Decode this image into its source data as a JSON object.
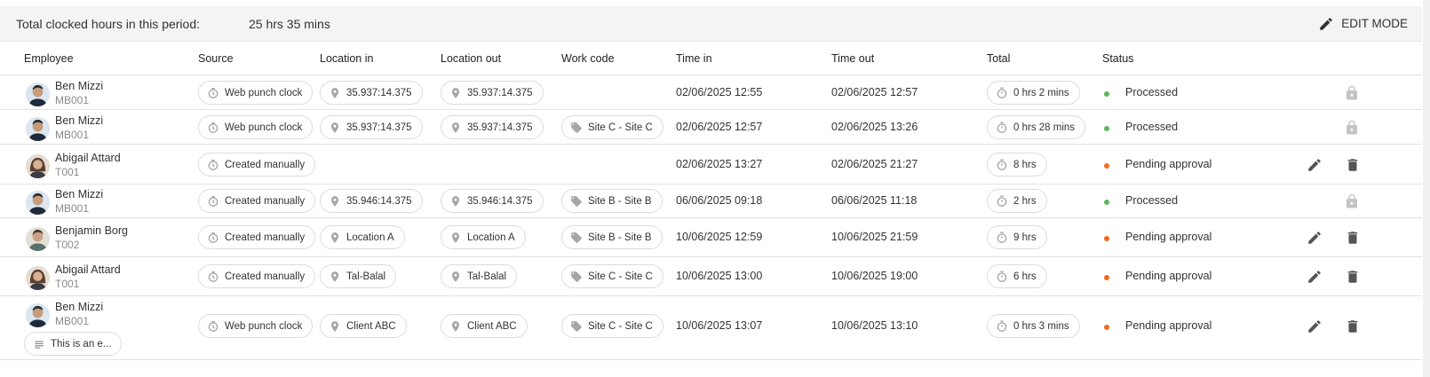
{
  "summary": {
    "label": "Total clocked hours in this period:",
    "value": "25 hrs 35 mins",
    "edit_mode_label": "EDIT MODE"
  },
  "columns": [
    "Employee",
    "Source",
    "Location in",
    "Location out",
    "Work code",
    "Time in",
    "Time out",
    "Total",
    "Status"
  ],
  "colors": {
    "processed": "#5cb85c",
    "pending": "#f26a1b",
    "icon": "#555555",
    "lock": "#c4c4c4"
  },
  "rows": [
    {
      "name": "Ben Mizzi",
      "code": "MB001",
      "avatar": "male-a",
      "source": "Web punch clock",
      "loc_in": "35.937:14.375",
      "loc_out": "35.937:14.375",
      "work_code": "",
      "time_in": "02/06/2025 12:55",
      "time_out": "02/06/2025 12:57",
      "total": "0 hrs 2 mins",
      "status": "Processed",
      "status_type": "processed",
      "note": ""
    },
    {
      "name": "Ben Mizzi",
      "code": "MB001",
      "avatar": "male-a",
      "source": "Web punch clock",
      "loc_in": "35.937:14.375",
      "loc_out": "35.937:14.375",
      "work_code": "Site C - Site C",
      "time_in": "02/06/2025 12:57",
      "time_out": "02/06/2025 13:26",
      "total": "0 hrs 28 mins",
      "status": "Processed",
      "status_type": "processed",
      "note": ""
    },
    {
      "name": "Abigail Attard",
      "code": "T001",
      "avatar": "female",
      "source": "Created manually",
      "loc_in": "",
      "loc_out": "",
      "work_code": "",
      "time_in": "02/06/2025 13:27",
      "time_out": "02/06/2025 21:27",
      "total": "8 hrs",
      "status": "Pending approval",
      "status_type": "pending",
      "note": ""
    },
    {
      "name": "Ben Mizzi",
      "code": "MB001",
      "avatar": "male-a",
      "source": "Created manually",
      "loc_in": "35.946:14.375",
      "loc_out": "35.946:14.375",
      "work_code": "Site B - Site B",
      "time_in": "06/06/2025 09:18",
      "time_out": "06/06/2025 11:18",
      "total": "2 hrs",
      "status": "Processed",
      "status_type": "processed",
      "note": ""
    },
    {
      "name": "Benjamin Borg",
      "code": "T002",
      "avatar": "male-b",
      "source": "Created manually",
      "loc_in": "Location A",
      "loc_out": "Location A",
      "work_code": "Site B - Site B",
      "time_in": "10/06/2025 12:59",
      "time_out": "10/06/2025 21:59",
      "total": "9 hrs",
      "status": "Pending approval",
      "status_type": "pending",
      "note": ""
    },
    {
      "name": "Abigail Attard",
      "code": "T001",
      "avatar": "female",
      "source": "Created manually",
      "loc_in": "Tal-Balal",
      "loc_out": "Tal-Balal",
      "work_code": "Site C - Site C",
      "time_in": "10/06/2025 13:00",
      "time_out": "10/06/2025 19:00",
      "total": "6 hrs",
      "status": "Pending approval",
      "status_type": "pending",
      "note": ""
    },
    {
      "name": "Ben Mizzi",
      "code": "MB001",
      "avatar": "male-a",
      "source": "Web punch clock",
      "loc_in": "Client ABC",
      "loc_out": "Client ABC",
      "work_code": "Site C - Site C",
      "time_in": "10/06/2025 13:07",
      "time_out": "10/06/2025 13:10",
      "total": "0 hrs 3 mins",
      "status": "Pending approval",
      "status_type": "pending",
      "note": "This is an e..."
    }
  ]
}
